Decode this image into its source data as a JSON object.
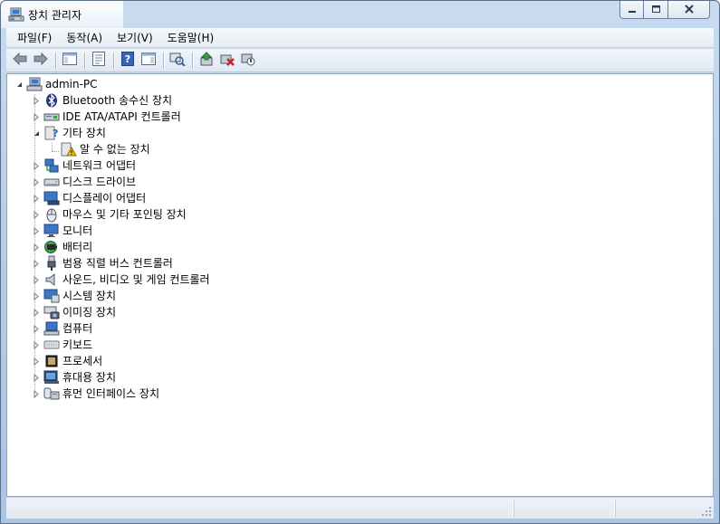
{
  "window": {
    "title": "장치 관리자",
    "title_icon": "device-manager-icon",
    "controls": {
      "minimize": "minimize-icon",
      "maximize": "maximize-icon",
      "close": "close-icon"
    }
  },
  "menu": {
    "items": [
      {
        "label": "파일(F)"
      },
      {
        "label": "동작(A)"
      },
      {
        "label": "보기(V)"
      },
      {
        "label": "도움말(H)"
      }
    ]
  },
  "toolbar": {
    "buttons": [
      "back-arrow-icon",
      "forward-arrow-icon",
      "separator",
      "show-hide-console-tree-icon",
      "separator",
      "properties-icon",
      "separator",
      "help-icon",
      "show-action-pane-icon",
      "separator",
      "scan-hardware-icon",
      "separator",
      "update-driver-icon",
      "uninstall-icon",
      "disable-icon"
    ]
  },
  "tree": {
    "root": {
      "label": "admin-PC",
      "icon": "computer-icon",
      "expanded": true
    },
    "items": [
      {
        "label": "Bluetooth 송수신 장치",
        "icon": "bluetooth-icon"
      },
      {
        "label": "IDE ATA/ATAPI 컨트롤러",
        "icon": "ide-controller-icon"
      },
      {
        "label": "기타 장치",
        "icon": "unknown-device-icon",
        "expanded": true,
        "children": [
          {
            "label": "알 수 없는 장치",
            "icon": "warning-device-icon"
          }
        ]
      },
      {
        "label": "네트워크 어댑터",
        "icon": "network-adapter-icon"
      },
      {
        "label": "디스크 드라이브",
        "icon": "disk-drive-icon"
      },
      {
        "label": "디스플레이 어댑터",
        "icon": "display-adapter-icon"
      },
      {
        "label": "마우스 및 기타 포인팅 장치",
        "icon": "mouse-icon"
      },
      {
        "label": "모니터",
        "icon": "monitor-icon"
      },
      {
        "label": "배터리",
        "icon": "battery-icon"
      },
      {
        "label": "범용 직렬 버스 컨트롤러",
        "icon": "usb-icon"
      },
      {
        "label": "사운드, 비디오 및 게임 컨트롤러",
        "icon": "sound-icon"
      },
      {
        "label": "시스템 장치",
        "icon": "system-device-icon"
      },
      {
        "label": "이미징 장치",
        "icon": "imaging-device-icon"
      },
      {
        "label": "컴퓨터",
        "icon": "computer-icon"
      },
      {
        "label": "키보드",
        "icon": "keyboard-icon"
      },
      {
        "label": "프로세서",
        "icon": "processor-icon"
      },
      {
        "label": "휴대용 장치",
        "icon": "portable-device-icon"
      },
      {
        "label": "휴먼 인터페이스 장치",
        "icon": "hid-icon"
      }
    ]
  }
}
